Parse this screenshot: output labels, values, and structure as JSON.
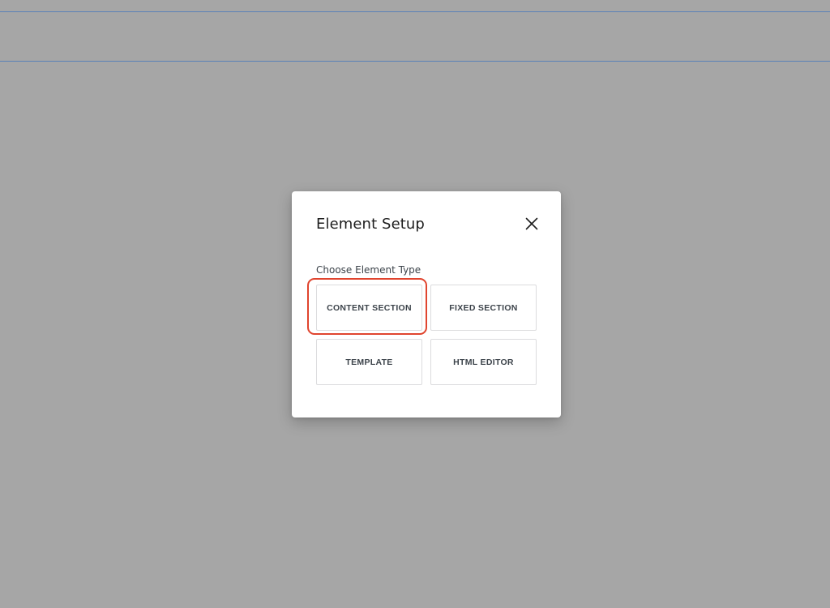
{
  "dialog": {
    "title": "Element Setup",
    "close_icon": "close-icon",
    "section_label": "Choose Element Type",
    "element_types": [
      {
        "label": "CONTENT SECTION",
        "highlighted": true
      },
      {
        "label": "FIXED SECTION",
        "highlighted": false
      },
      {
        "label": "TEMPLATE",
        "highlighted": false
      },
      {
        "label": "HTML EDITOR",
        "highlighted": false
      }
    ],
    "highlight_color": "#e0442e"
  },
  "colors": {
    "backdrop": "#a6a6a6",
    "guide_lines": "#5b82b8"
  }
}
